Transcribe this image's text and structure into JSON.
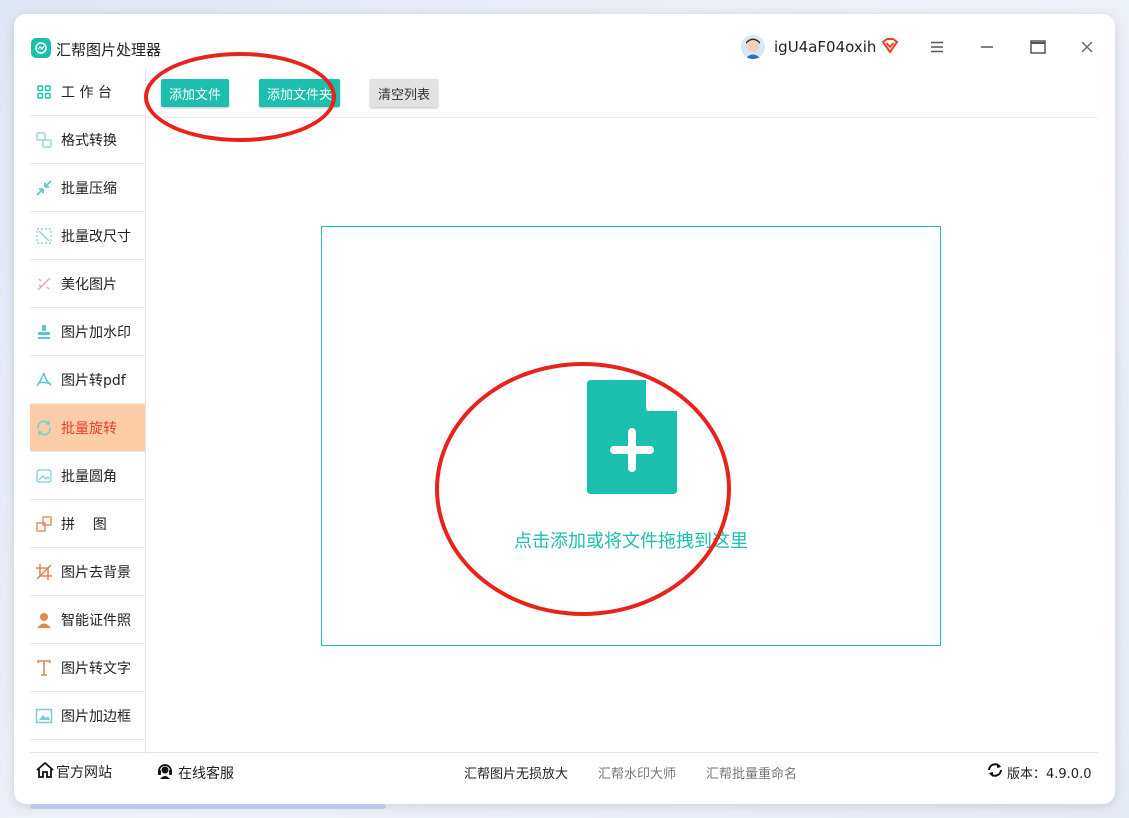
{
  "app": {
    "title": "汇帮图片处理器",
    "username": "igU4aF04oxih"
  },
  "colors": {
    "accent": "#1cbfad",
    "active_bg": "#fccda6",
    "active_text": "#e8402c",
    "annotation": "#e8231b"
  },
  "sidebar": {
    "items": [
      {
        "label": "工 作 台",
        "icon": "grid-icon"
      },
      {
        "label": "格式转换",
        "icon": "convert-icon"
      },
      {
        "label": "批量压缩",
        "icon": "compress-icon"
      },
      {
        "label": "批量改尺寸",
        "icon": "resize-icon"
      },
      {
        "label": "美化图片",
        "icon": "beautify-icon"
      },
      {
        "label": "图片加水印",
        "icon": "stamp-icon"
      },
      {
        "label": "图片转pdf",
        "icon": "pdf-icon"
      },
      {
        "label": "批量旋转",
        "icon": "rotate-icon",
        "active": true
      },
      {
        "label": "批量圆角",
        "icon": "round-corner-icon"
      },
      {
        "label": "拼    图",
        "icon": "puzzle-icon"
      },
      {
        "label": "图片去背景",
        "icon": "crop-icon"
      },
      {
        "label": "智能证件照",
        "icon": "person-icon"
      },
      {
        "label": "图片转文字",
        "icon": "text-icon"
      },
      {
        "label": "图片加边框",
        "icon": "frame-icon"
      }
    ]
  },
  "toolbar": {
    "add_file": "添加文件",
    "add_folder": "添加文件夹",
    "clear_list": "清空列表"
  },
  "dropzone": {
    "text": "点击添加或将文件拖拽到这里"
  },
  "footer": {
    "official_site": "官方网站",
    "online_service": "在线客服",
    "link1": "汇帮图片无损放大",
    "link2": "汇帮水印大师",
    "link3": "汇帮批量重命名",
    "version": "版本：4.9.0.0"
  }
}
